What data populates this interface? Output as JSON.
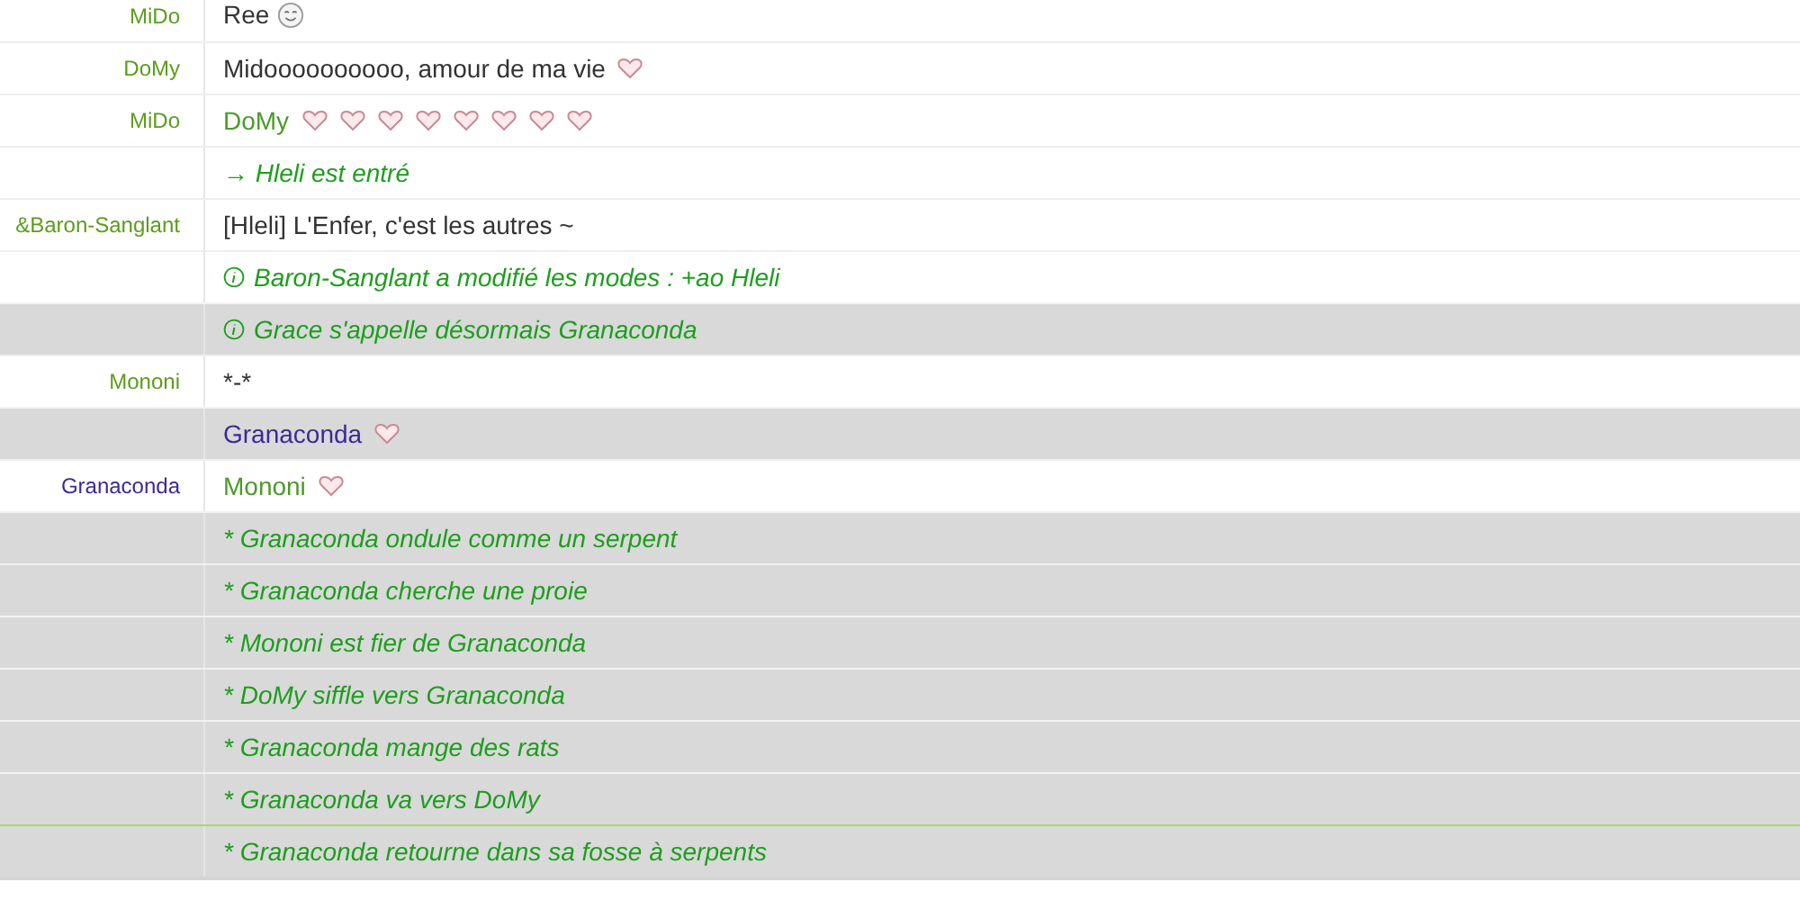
{
  "messages": [
    {
      "kind": "message",
      "nick": {
        "text": "MiDo",
        "color": "#5c9c1c"
      },
      "body": {
        "text": "Ree",
        "color": "#333333"
      },
      "highlighted": false,
      "marker": false,
      "emotes": [
        {
          "kind": "smiley"
        }
      ]
    },
    {
      "kind": "message",
      "nick": {
        "text": "DoMy",
        "color": "#5c9c1c"
      },
      "body": {
        "text": "Midoooooooooo, amour de ma vie",
        "color": "#333333"
      },
      "highlighted": false,
      "marker": false,
      "emotes": [
        {
          "kind": "heart"
        }
      ]
    },
    {
      "kind": "message",
      "nick": {
        "text": "MiDo",
        "color": "#5c9c1c"
      },
      "body": {
        "text": "DoMy",
        "color": "#4c9a2a"
      },
      "highlighted": false,
      "marker": false,
      "emotes": [
        {
          "kind": "heart"
        },
        {
          "kind": "heart"
        },
        {
          "kind": "heart"
        },
        {
          "kind": "heart"
        },
        {
          "kind": "heart"
        },
        {
          "kind": "heart"
        },
        {
          "kind": "heart"
        },
        {
          "kind": "heart"
        }
      ]
    },
    {
      "kind": "event",
      "text": "→ Hleli est entré",
      "highlighted": false,
      "marker": false
    },
    {
      "kind": "message",
      "nick": {
        "text": "&Baron-Sanglant",
        "color": "#5c9c1c"
      },
      "body": {
        "text": "[Hleli] L'Enfer, c'est les autres ~",
        "color": "#333333"
      },
      "highlighted": false,
      "marker": false
    },
    {
      "kind": "info",
      "text": "Baron-Sanglant a modifié les modes : +ao Hleli",
      "highlighted": false,
      "marker": false
    },
    {
      "kind": "info",
      "text": "Grace s'appelle désormais Granaconda",
      "highlighted": true,
      "marker": false
    },
    {
      "kind": "message",
      "nick": {
        "text": "Mononi",
        "color": "#5c9c1c"
      },
      "body": {
        "text": "*-*",
        "color": "#333333"
      },
      "highlighted": false,
      "marker": false
    },
    {
      "kind": "message",
      "body": {
        "text": "Granaconda",
        "color": "#3a2a9a"
      },
      "highlighted": true,
      "marker": false,
      "emotes": [
        {
          "kind": "heart"
        }
      ]
    },
    {
      "kind": "message",
      "nick": {
        "text": "Granaconda",
        "color": "#3a2a9a"
      },
      "body": {
        "text": "Mononi",
        "color": "#4c9a2a"
      },
      "highlighted": false,
      "marker": false,
      "emotes": [
        {
          "kind": "heart"
        }
      ]
    },
    {
      "kind": "event",
      "text": "* Granaconda ondule comme un serpent",
      "highlighted": true,
      "marker": false
    },
    {
      "kind": "event",
      "text": "* Granaconda cherche une proie",
      "highlighted": true,
      "marker": false
    },
    {
      "kind": "event",
      "text": "* Mononi est fier de Granaconda",
      "highlighted": true,
      "marker": false
    },
    {
      "kind": "event",
      "text": "* DoMy siffle vers Granaconda",
      "highlighted": true,
      "marker": false
    },
    {
      "kind": "event",
      "text": "* Granaconda mange des rats",
      "highlighted": true,
      "marker": false
    },
    {
      "kind": "event",
      "text": "* Granaconda va vers DoMy",
      "highlighted": true,
      "marker": false
    },
    {
      "kind": "event",
      "text": "* Granaconda retourne dans sa fosse à serpents",
      "highlighted": true,
      "marker": true
    }
  ]
}
